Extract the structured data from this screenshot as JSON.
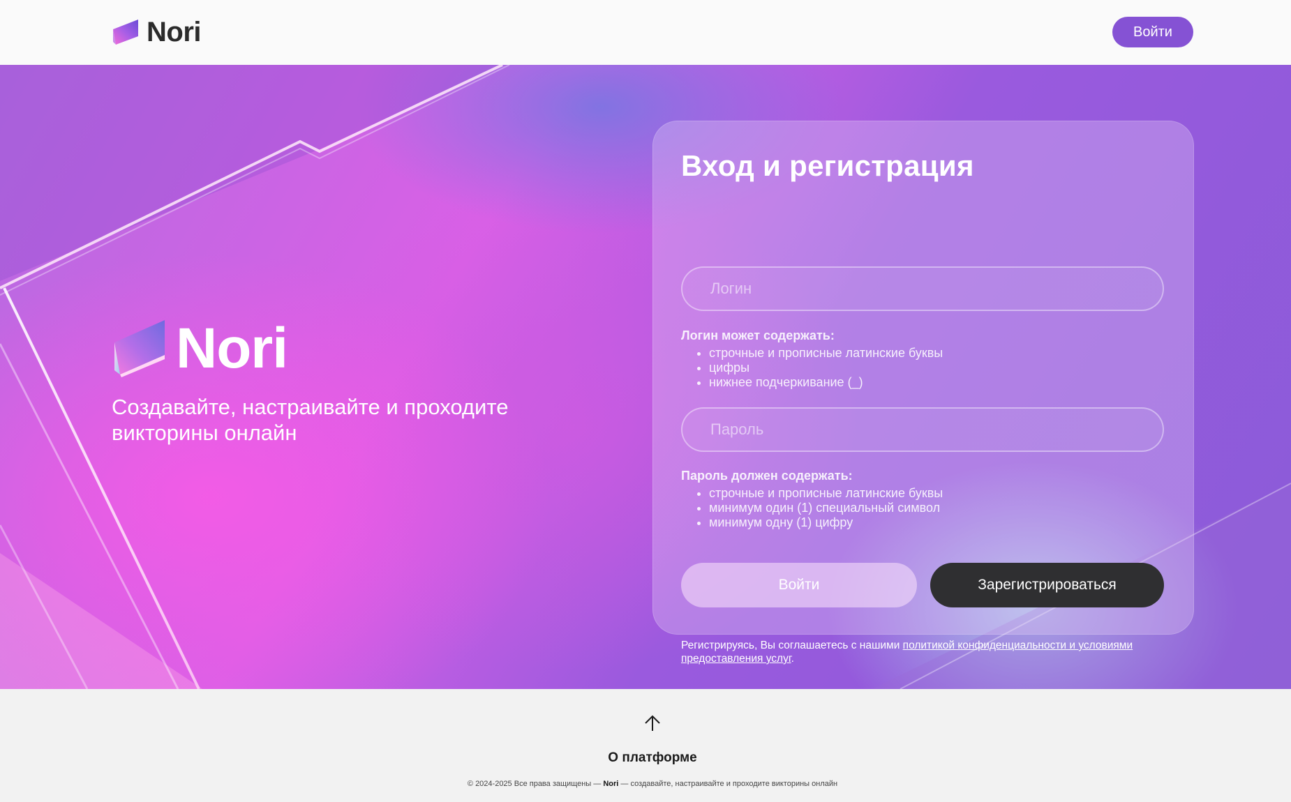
{
  "header": {
    "logo_text": "Nori",
    "login_button": "Войти"
  },
  "hero": {
    "logo_text": "Nori",
    "tagline": "Создавайте, настраивайте и проходите викторины онлайн"
  },
  "auth": {
    "title": "Вход и регистрация",
    "login_placeholder": "Логин",
    "login_rules_title": "Логин может содержать:",
    "login_rules": [
      "строчные и прописные латинские буквы",
      "цифры",
      "нижнее подчеркивание (_)"
    ],
    "password_placeholder": "Пароль",
    "password_rules_title": "Пароль должен содержать:",
    "password_rules": [
      "строчные и прописные латинские буквы",
      "минимум один (1) специальный символ",
      "минимум одну (1) цифру"
    ],
    "login_button": "Войти",
    "register_button": "Зарегистрироваться",
    "consent_prefix": "Регистрируясь, Вы соглашаетесь с нашими ",
    "consent_link": "политикой конфиденциальности и условиями предоставления услуг",
    "consent_suffix": "."
  },
  "footer": {
    "up_icon": "arrow-up-icon",
    "about_link": "О платформе",
    "copyright_prefix": "© 2024-2025 Все права защищены — ",
    "copyright_brand": "Nori",
    "copyright_suffix": " — создавайте, настраивайте и проходите викторины онлайн"
  },
  "colors": {
    "accent": "#8552d4",
    "dark_button": "#2f2f31",
    "footer_bg": "#f2f2f2"
  }
}
